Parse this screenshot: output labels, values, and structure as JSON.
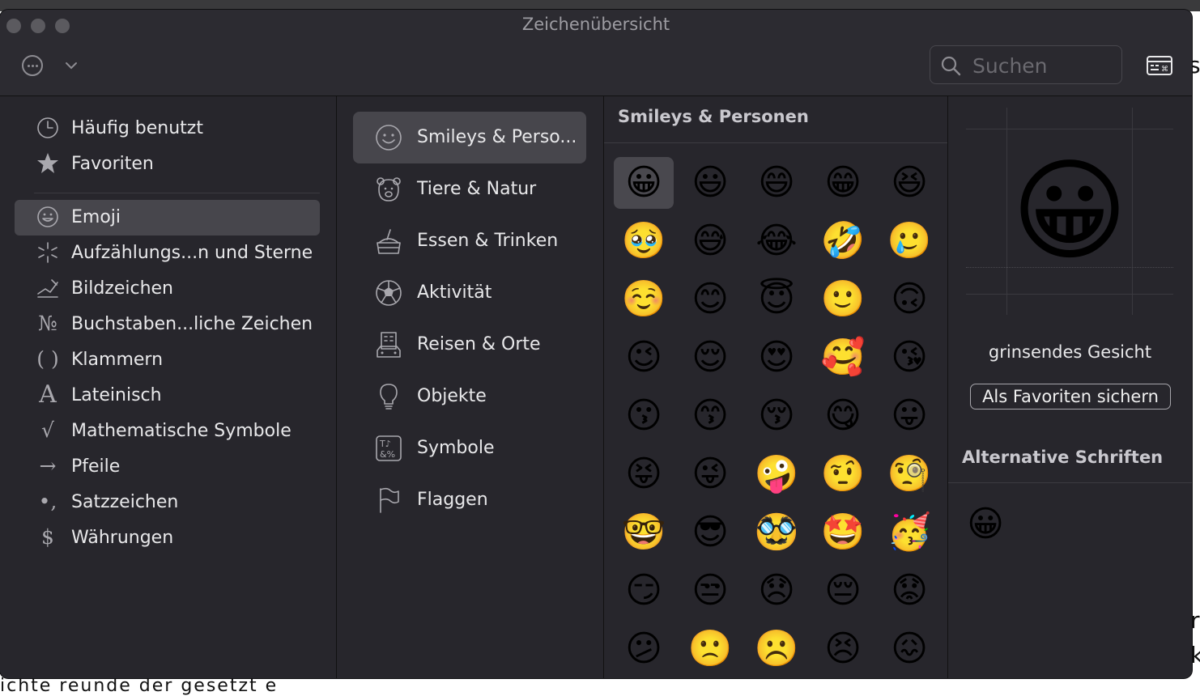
{
  "window": {
    "title": "Zeichenübersicht"
  },
  "toolbar": {
    "search_placeholder": "Suchen"
  },
  "sidebar": {
    "items": [
      {
        "label": "Häufig benutzt",
        "icon": "clock-icon"
      },
      {
        "label": "Favoriten",
        "icon": "star-icon"
      },
      {
        "label": "Emoji",
        "icon": "smiley-icon"
      },
      {
        "label": "Aufzählungs...n und Sterne",
        "icon": "asterisk-icon"
      },
      {
        "label": "Bildzeichen",
        "icon": "pictograph-icon"
      },
      {
        "label": "Buchstaben...liche Zeichen",
        "icon": "numero-icon"
      },
      {
        "label": "Klammern",
        "icon": "parentheses-icon"
      },
      {
        "label": "Lateinisch",
        "icon": "latin-a-icon"
      },
      {
        "label": "Mathematische Symbole",
        "icon": "square-root-icon"
      },
      {
        "label": "Pfeile",
        "icon": "arrow-icon"
      },
      {
        "label": "Satzzeichen",
        "icon": "punctuation-icon"
      },
      {
        "label": "Währungen",
        "icon": "dollar-icon"
      }
    ],
    "selected": "Emoji"
  },
  "subcategories": {
    "items": [
      {
        "label": "Smileys & Perso...",
        "icon": "smiley-icon"
      },
      {
        "label": "Tiere & Natur",
        "icon": "bear-icon"
      },
      {
        "label": "Essen & Trinken",
        "icon": "food-icon"
      },
      {
        "label": "Aktivität",
        "icon": "soccer-ball-icon"
      },
      {
        "label": "Reisen & Orte",
        "icon": "building-icon"
      },
      {
        "label": "Objekte",
        "icon": "lightbulb-icon"
      },
      {
        "label": "Symbole",
        "icon": "symbols-icon"
      },
      {
        "label": "Flaggen",
        "icon": "flag-icon"
      }
    ],
    "selected": "Smileys & Perso..."
  },
  "grid": {
    "title": "Smileys & Personen",
    "emojis": [
      "😀",
      "😃",
      "😄",
      "😁",
      "😆",
      "🥹",
      "😅",
      "😂",
      "🤣",
      "🥲",
      "☺️",
      "😊",
      "😇",
      "🙂",
      "🙃",
      "😉",
      "😌",
      "😍",
      "🥰",
      "😘",
      "😗",
      "😙",
      "😚",
      "😋",
      "😛",
      "😝",
      "😜",
      "🤪",
      "🤨",
      "🧐",
      "🤓",
      "😎",
      "🥸",
      "🤩",
      "🥳",
      "😏",
      "😒",
      "😞",
      "😔",
      "😟",
      "😕",
      "🙁",
      "☹️",
      "😣",
      "😖"
    ],
    "selected_index": 0
  },
  "detail": {
    "emoji": "😀",
    "name": "grinsendes Gesicht",
    "favorite_button": "Als Favoriten sichern",
    "alt_fonts_title": "Alternative Schriften",
    "alt_emoji": "😀"
  },
  "background": {
    "right_glyphs": [
      "s",
      "r",
      "k"
    ],
    "bottom_text": "ichte  reunde  der  gesetzt  e"
  }
}
